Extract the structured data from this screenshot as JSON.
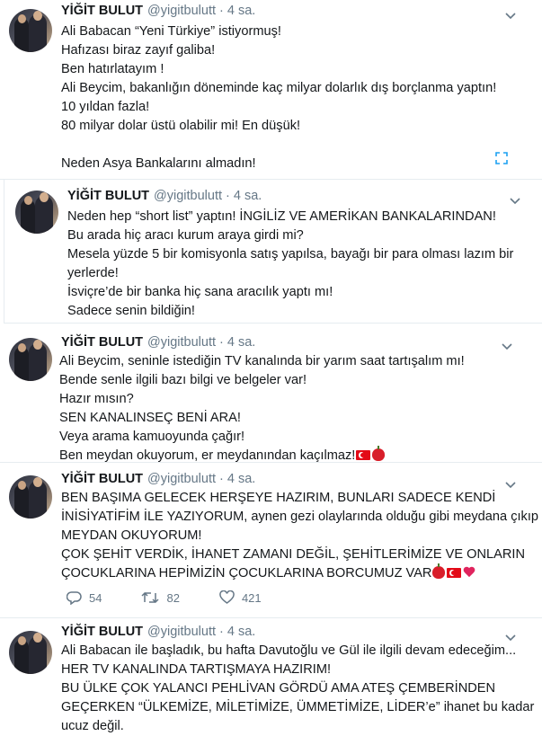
{
  "tweets": [
    {
      "name": "YİĞİT BULUT",
      "handle": "@yigitbulutt",
      "separator": "·",
      "time": "4 sa.",
      "lines": [
        "Ali Babacan “Yeni Türkiye” istiyormuş!",
        "Hafızası biraz zayıf galiba!",
        "Ben hatırlatayım !",
        "Ali Beycim, bakanlığın döneminde kaç milyar dolarlık dış borçlanma yaptın!",
        "10 yıldan fazla!",
        "80 milyar dolar üstü olabilir mi! En düşük!",
        "",
        "Neden Asya Bankalarını almadın!"
      ]
    },
    {
      "name": "YİĞİT BULUT",
      "handle": "@yigitbulutt",
      "separator": "·",
      "time": "4 sa.",
      "lines": [
        "Neden hep “short list” yaptın! İNGİLİZ VE AMERİKAN BANKALARINDAN!",
        "Bu arada hiç aracı kurum araya girdi mi?",
        "Mesela yüzde 5 bir komisyonla satış yapılsa, bayağı bir para olması lazım bir",
        "yerlerde!",
        "İsviçre’de bir banka hiç sana aracılık yaptı mı!",
        "Sadece senin bildiğin!"
      ]
    },
    {
      "name": "YİĞİT BULUT",
      "handle": "@yigitbulutt",
      "separator": "·",
      "time": "4 sa.",
      "lines": [
        "Ali Beycim, seninle istediğin TV kanalında bir yarım saat tartışalım mı!",
        "Bende senle ilgili bazı bilgi ve belgeler var!",
        "Hazır mısın?",
        "SEN KANALINSEÇ BENİ ARA!",
        "Veya arama kamuoyunda çağır!",
        "Ben meydan okuyorum, er meydanından kaçılmaz!"
      ]
    },
    {
      "name": "YİĞİT BULUT",
      "handle": "@yigitbulutt",
      "separator": "·",
      "time": "4 sa.",
      "lines": [
        "BEN BAŞIMA GELECEK HERŞEYE HAZIRIM, BUNLARI SADECE KENDİ",
        "İNİSİYATİFİM İLE YAZIYORUM, aynen gezi olaylarında olduğu gibi meydana çıkıp",
        "MEYDAN OKUYORUM!",
        "ÇOK ŞEHİT VERDİK, İHANET ZAMANI DEĞİL, ŞEHİTLERİMİZE VE ONLARIN",
        "ÇOCUKLARINA HEPİMİZİN ÇOCUKLARINA BORCUMUZ VAR"
      ],
      "replies": "54",
      "retweets": "82",
      "likes": "421"
    },
    {
      "name": "YİĞİT BULUT",
      "handle": "@yigitbulutt",
      "separator": "·",
      "time": "4 sa.",
      "lines": [
        "Ali Babacan ile başladık, bu hafta Davutoğlu ve Gül ile ilgili devam edeceğim...",
        "HER TV KANALINDA TARTIŞMAYA HAZIRIM!",
        "BU ÜLKE ÇOK YALANCI PEHLİVAN GÖRDÜ AMA ATEŞ ÇEMBERİNDEN",
        "GEÇERKEN “ÜLKEMİZE, MİLETİMİZE, ÜMMETİMİZE, LİDER’e” ihanet bu kadar",
        "ucuz değil."
      ]
    }
  ],
  "icons": {
    "caret": "chevron-down-icon",
    "expand": "expand-icon",
    "reply": "reply-icon",
    "retweet": "retweet-icon",
    "like": "heart-icon",
    "flag": "turkey-flag-emoji",
    "apple": "red-apple-emoji",
    "heart_emoji": "red-heart-emoji"
  },
  "colors": {
    "text": "#14171a",
    "muted": "#657786",
    "border": "#e6ecf0",
    "link": "#1da1f2"
  }
}
